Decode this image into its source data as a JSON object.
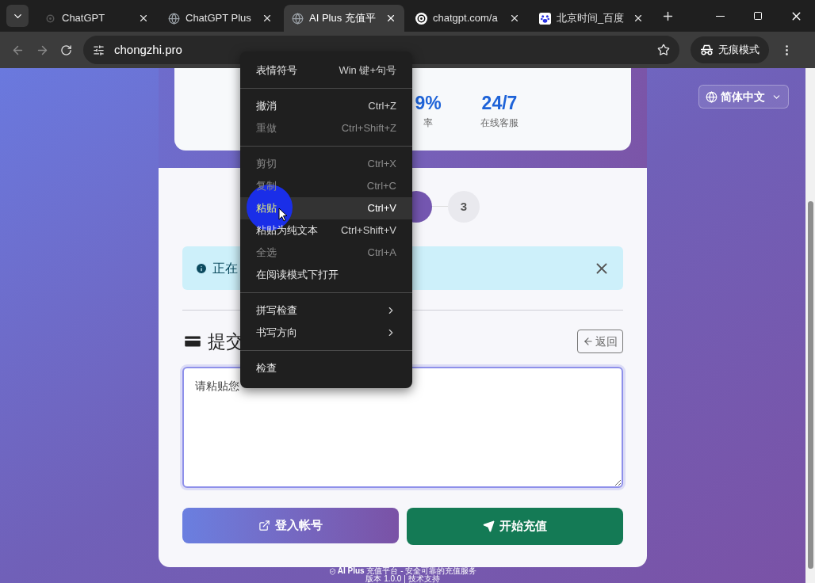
{
  "browser": {
    "tabs": [
      {
        "title": "ChatGPT",
        "kind": "openai-dark",
        "selected": false
      },
      {
        "title": "ChatGPT Plus",
        "kind": "globe",
        "selected": false
      },
      {
        "title": "AI Plus 充值平",
        "kind": "globe",
        "selected": true
      },
      {
        "title": "chatgpt.com/a",
        "kind": "openai-light",
        "selected": false
      },
      {
        "title": "北京时间_百度",
        "kind": "paw",
        "selected": false
      }
    ],
    "address": "chongzhi.pro",
    "incognito_label": "无痕模式"
  },
  "page": {
    "language": "简体中文",
    "stats": [
      {
        "value": "9%",
        "label": "率"
      },
      {
        "value": "24/7",
        "label": "在线客服"
      }
    ],
    "steps": [
      {
        "active": true
      },
      {
        "label": "3",
        "active": false
      }
    ],
    "alert": {
      "text": "正在"
    },
    "heading": "提交",
    "back_button": "返回",
    "textarea": {
      "placeholder": "请粘贴您"
    },
    "buttons": [
      {
        "kind": "login",
        "label": "登入帐号"
      },
      {
        "kind": "start",
        "label": "开始充值"
      }
    ],
    "footer": {
      "title": "AI Plus",
      "tagline": "充值平台 - 安全可靠的充值服务",
      "version": "版本 1.0.0 | 技术支持"
    }
  },
  "context_menu": {
    "groups": [
      [
        {
          "label": "表情符号",
          "shortcut": "Win 键+句号",
          "disabled": false,
          "selected": false,
          "submenu": false
        }
      ],
      [
        {
          "label": "撤消",
          "shortcut": "Ctrl+Z",
          "disabled": false,
          "selected": false,
          "submenu": false
        },
        {
          "label": "重做",
          "shortcut": "Ctrl+Shift+Z",
          "disabled": true,
          "selected": false,
          "submenu": false
        }
      ],
      [
        {
          "label": "剪切",
          "shortcut": "Ctrl+X",
          "disabled": true,
          "selected": false,
          "submenu": false
        },
        {
          "label": "复制",
          "shortcut": "Ctrl+C",
          "disabled": true,
          "selected": false,
          "submenu": false
        },
        {
          "label": "粘贴",
          "shortcut": "Ctrl+V",
          "disabled": false,
          "selected": true,
          "submenu": false
        },
        {
          "label": "粘贴为纯文本",
          "shortcut": "Ctrl+Shift+V",
          "disabled": false,
          "selected": false,
          "submenu": false
        },
        {
          "label": "全选",
          "shortcut": "Ctrl+A",
          "disabled": true,
          "selected": false,
          "submenu": false
        },
        {
          "label": "在阅读模式下打开",
          "disabled": false,
          "selected": false,
          "submenu": false
        }
      ],
      [
        {
          "label": "拼写检查",
          "disabled": false,
          "selected": false,
          "submenu": true
        },
        {
          "label": "书写方向",
          "disabled": false,
          "selected": false,
          "submenu": true
        }
      ],
      [
        {
          "label": "检查",
          "disabled": false,
          "selected": false,
          "submenu": false
        }
      ]
    ]
  }
}
